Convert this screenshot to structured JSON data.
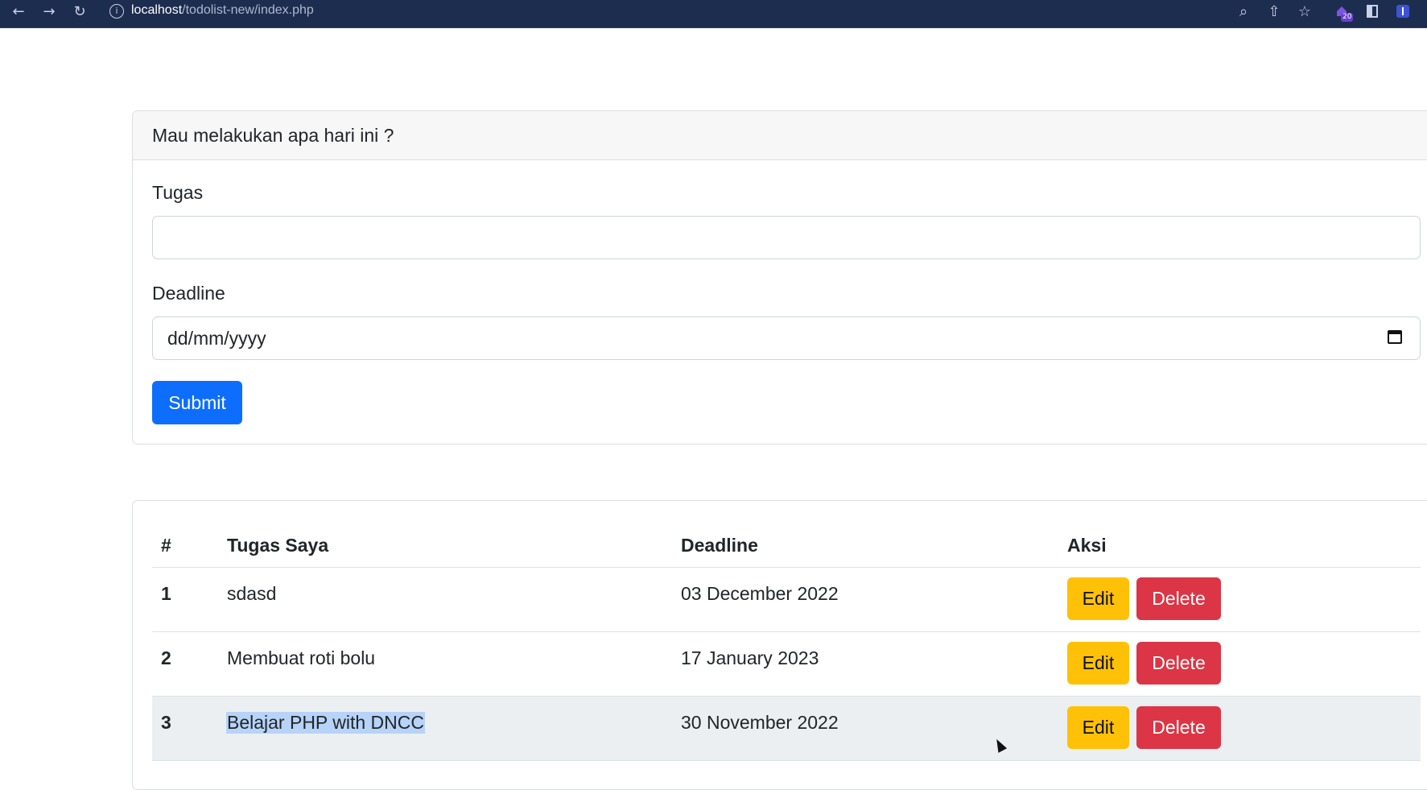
{
  "browser": {
    "url_host": "localhost",
    "url_path": "/todolist-new/index.php",
    "back_icon": "←",
    "forward_icon": "→",
    "reload_icon": "↻",
    "info_icon": "i",
    "zoom_icon": "⌕",
    "share_icon": "⇧",
    "star_icon": "☆",
    "ext_badge": "20"
  },
  "form": {
    "header": "Mau melakukan apa hari ini ?",
    "task_label": "Tugas",
    "task_value": "",
    "deadline_label": "Deadline",
    "deadline_placeholder": "dd/mm/yyyy",
    "submit_label": "Submit"
  },
  "table": {
    "columns": [
      "#",
      "Tugas Saya",
      "Deadline",
      "Aksi"
    ],
    "rows": [
      {
        "no": "1",
        "task": "sdasd",
        "deadline": "03 December 2022",
        "edit": "Edit",
        "delete": "Delete"
      },
      {
        "no": "2",
        "task": "Membuat roti bolu",
        "deadline": "17 January 2023",
        "edit": "Edit",
        "delete": "Delete"
      },
      {
        "no": "3",
        "task": "Belajar PHP with DNCC",
        "deadline": "30 November 2022",
        "edit": "Edit",
        "delete": "Delete"
      }
    ]
  },
  "colors": {
    "primary": "#0d6efd",
    "warning": "#ffc107",
    "danger": "#dc3545",
    "chrome": "#1d2d4f"
  }
}
